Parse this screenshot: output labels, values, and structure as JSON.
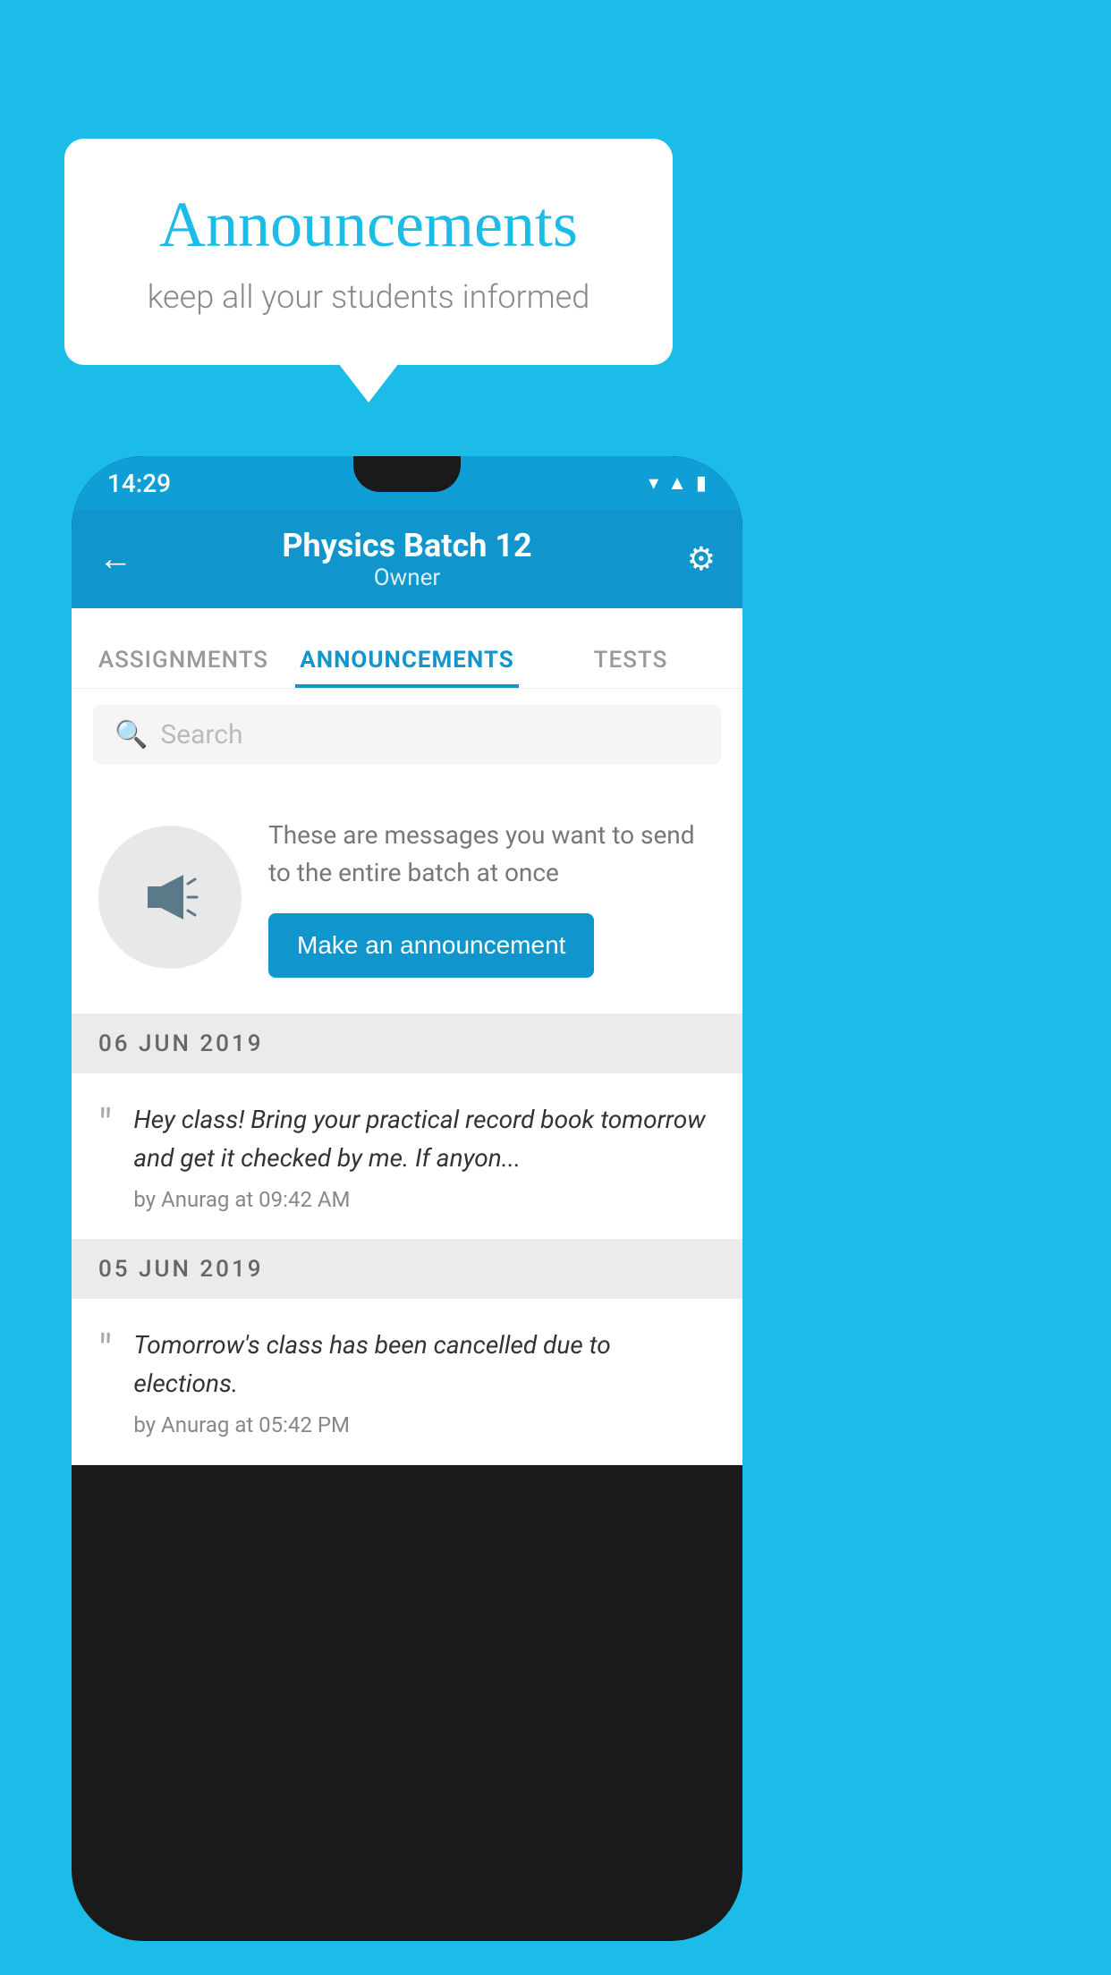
{
  "background_color": "#1BBDE8",
  "speech_bubble": {
    "title": "Announcements",
    "subtitle": "keep all your students informed"
  },
  "phone": {
    "status_bar": {
      "time": "14:29",
      "wifi": "wifi",
      "signal": "signal",
      "battery": "battery"
    },
    "app_bar": {
      "back_icon": "←",
      "title": "Physics Batch 12",
      "subtitle": "Owner",
      "gear_icon": "⚙"
    },
    "tabs": [
      {
        "label": "ASSIGNMENTS",
        "active": false
      },
      {
        "label": "ANNOUNCEMENTS",
        "active": true
      },
      {
        "label": "TESTS",
        "active": false
      },
      {
        "label": "...",
        "active": false
      }
    ],
    "search": {
      "placeholder": "Search",
      "icon": "search"
    },
    "announcement_prompt": {
      "description_text": "These are messages you want to send to the entire batch at once",
      "button_label": "Make an announcement"
    },
    "messages": [
      {
        "date": "06  JUN  2019",
        "items": [
          {
            "text": "Hey class! Bring your practical record book tomorrow and get it checked by me. If anyon...",
            "meta": "by Anurag at 09:42 AM"
          }
        ]
      },
      {
        "date": "05  JUN  2019",
        "items": [
          {
            "text": "Tomorrow's class has been cancelled due to elections.",
            "meta": "by Anurag at 05:42 PM"
          }
        ]
      }
    ]
  }
}
